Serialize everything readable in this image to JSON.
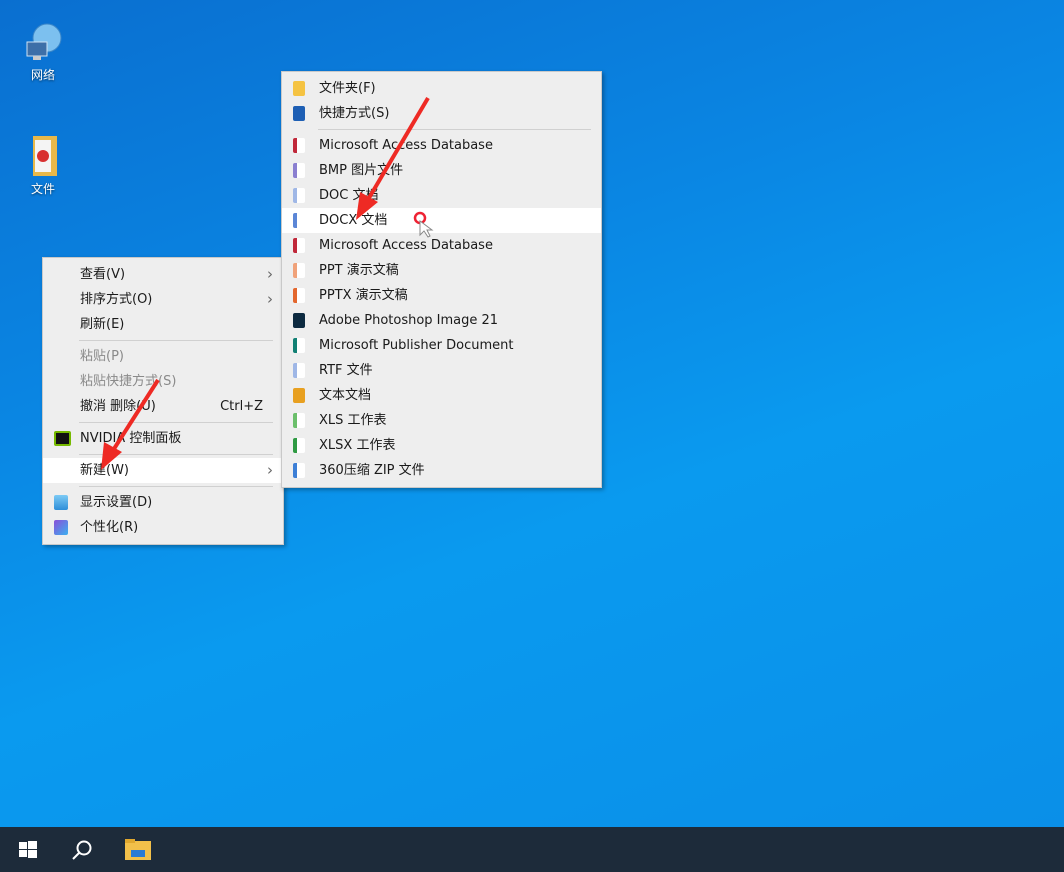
{
  "desktop": {
    "icons": [
      {
        "label": "网络",
        "icon": "network-icon"
      },
      {
        "label": "文件",
        "icon": "folder-icon"
      }
    ]
  },
  "context_menu": {
    "items": [
      {
        "label": "查看(V)",
        "submenu": true
      },
      {
        "label": "排序方式(O)",
        "submenu": true
      },
      {
        "label": "刷新(E)"
      },
      {
        "label": "粘贴(P)",
        "disabled": true
      },
      {
        "label": "粘贴快捷方式(S)",
        "disabled": true
      },
      {
        "label": "撤消 删除(U)",
        "shortcut": "Ctrl+Z"
      },
      {
        "label": "NVIDIA 控制面板",
        "icon": "nvidia-icon"
      },
      {
        "label": "新建(W)",
        "submenu": true,
        "highlighted": true
      },
      {
        "label": "显示设置(D)",
        "icon": "display-icon"
      },
      {
        "label": "个性化(R)",
        "icon": "personalize-icon"
      }
    ]
  },
  "new_submenu": {
    "items": [
      {
        "label": "文件夹(F)",
        "icon": "folder-icon",
        "color": "#f5c342"
      },
      {
        "label": "快捷方式(S)",
        "icon": "shortcut-icon",
        "color": "#1e5fb4"
      },
      {
        "label": "Microsoft Access Database",
        "icon": "access-icon",
        "color": "#c0283a"
      },
      {
        "label": "BMP 图片文件",
        "icon": "bmp-icon",
        "color": "#8a7fd0"
      },
      {
        "label": "DOC 文档",
        "icon": "doc-icon",
        "color": "#9fb7e6"
      },
      {
        "label": "DOCX 文档",
        "icon": "docx-icon",
        "color": "#5b86d6",
        "highlighted": true
      },
      {
        "label": "Microsoft Access Database",
        "icon": "access-icon",
        "color": "#c0283a"
      },
      {
        "label": "PPT 演示文稿",
        "icon": "ppt-icon",
        "color": "#f0a27a"
      },
      {
        "label": "PPTX 演示文稿",
        "icon": "pptx-icon",
        "color": "#e3672e"
      },
      {
        "label": "Adobe Photoshop Image 21",
        "icon": "photoshop-icon",
        "color": "#0d2a40"
      },
      {
        "label": "Microsoft Publisher Document",
        "icon": "publisher-icon",
        "color": "#128074"
      },
      {
        "label": "RTF 文件",
        "icon": "rtf-icon",
        "color": "#9fb7e6"
      },
      {
        "label": "文本文档",
        "icon": "text-icon",
        "color": "#e8a020"
      },
      {
        "label": "XLS 工作表",
        "icon": "xls-icon",
        "color": "#6bbf6b"
      },
      {
        "label": "XLSX 工作表",
        "icon": "xlsx-icon",
        "color": "#2f9a43"
      },
      {
        "label": "360压缩 ZIP 文件",
        "icon": "zip-icon",
        "color": "#3d7fd6"
      }
    ]
  },
  "taskbar": {
    "icons": [
      "windows-start-icon",
      "search-icon",
      "file-explorer-icon"
    ]
  },
  "colors": {
    "annotation_arrow": "#ee2a24",
    "taskbar": "#1d2b3a"
  }
}
